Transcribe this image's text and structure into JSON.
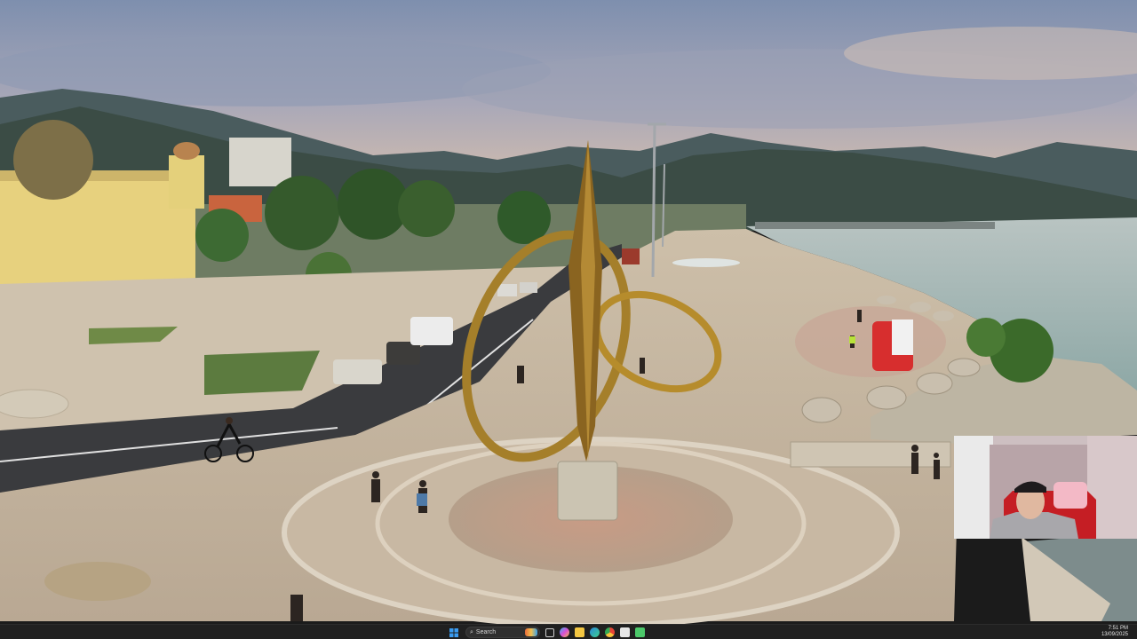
{
  "taskbar": {
    "search_label": "Search",
    "time": "7:51 PM",
    "date": "13/09/2025",
    "pinned_icons": [
      "start-icon",
      "search-icon",
      "widgets-icon",
      "task-view-icon",
      "copilot-icon",
      "file-explorer-icon",
      "edge-icon",
      "chrome-icon",
      "store-icon",
      "app-icon"
    ]
  },
  "colors": {
    "taskbar_bg": "#202020",
    "sky_top": "#7f93b0",
    "sea": "#a6b8b4",
    "promenade": "#c9b9a2"
  }
}
